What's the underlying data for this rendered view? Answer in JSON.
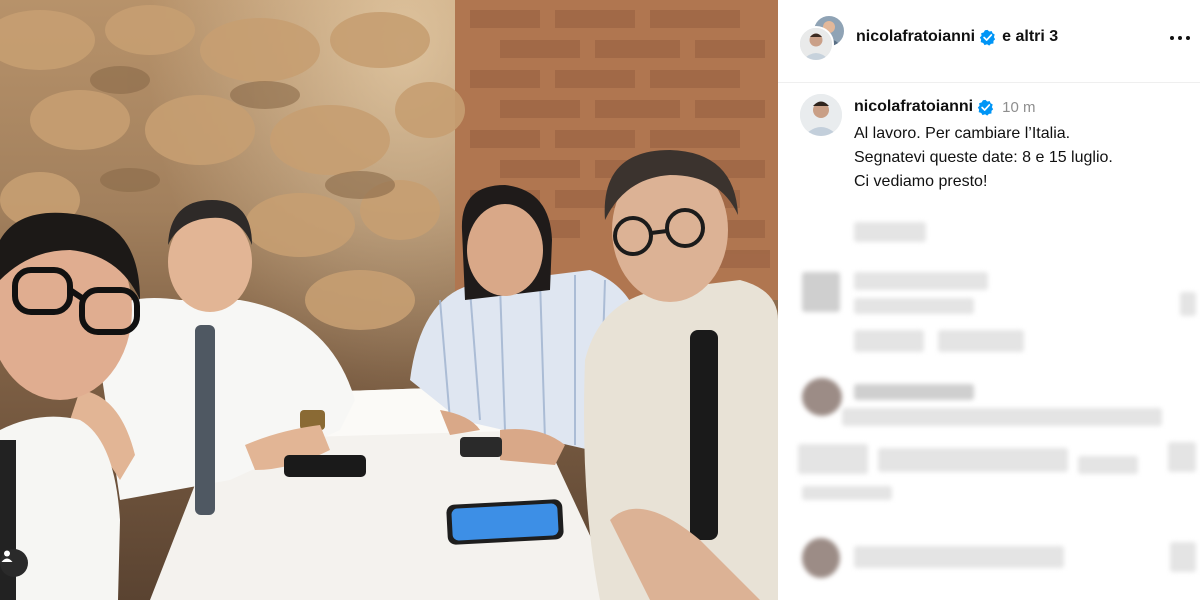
{
  "post": {
    "header": {
      "username": "nicolafratoianni",
      "others_label": "e altri 3",
      "more_icon": "more-horizontal-icon",
      "verified_icon": "verified-badge-icon"
    },
    "caption": {
      "username": "nicolafratoianni",
      "time": "10 m",
      "lines": [
        "Al lavoro. Per cambiare l’Italia.",
        "Segnatevi queste date: 8 e 15 luglio.",
        "Ci vediamo presto!"
      ]
    },
    "photo": {
      "tag_icon": "user-tag-icon"
    },
    "colors": {
      "verified": "#0095f6",
      "muted_text": "#8e8e8e"
    }
  }
}
